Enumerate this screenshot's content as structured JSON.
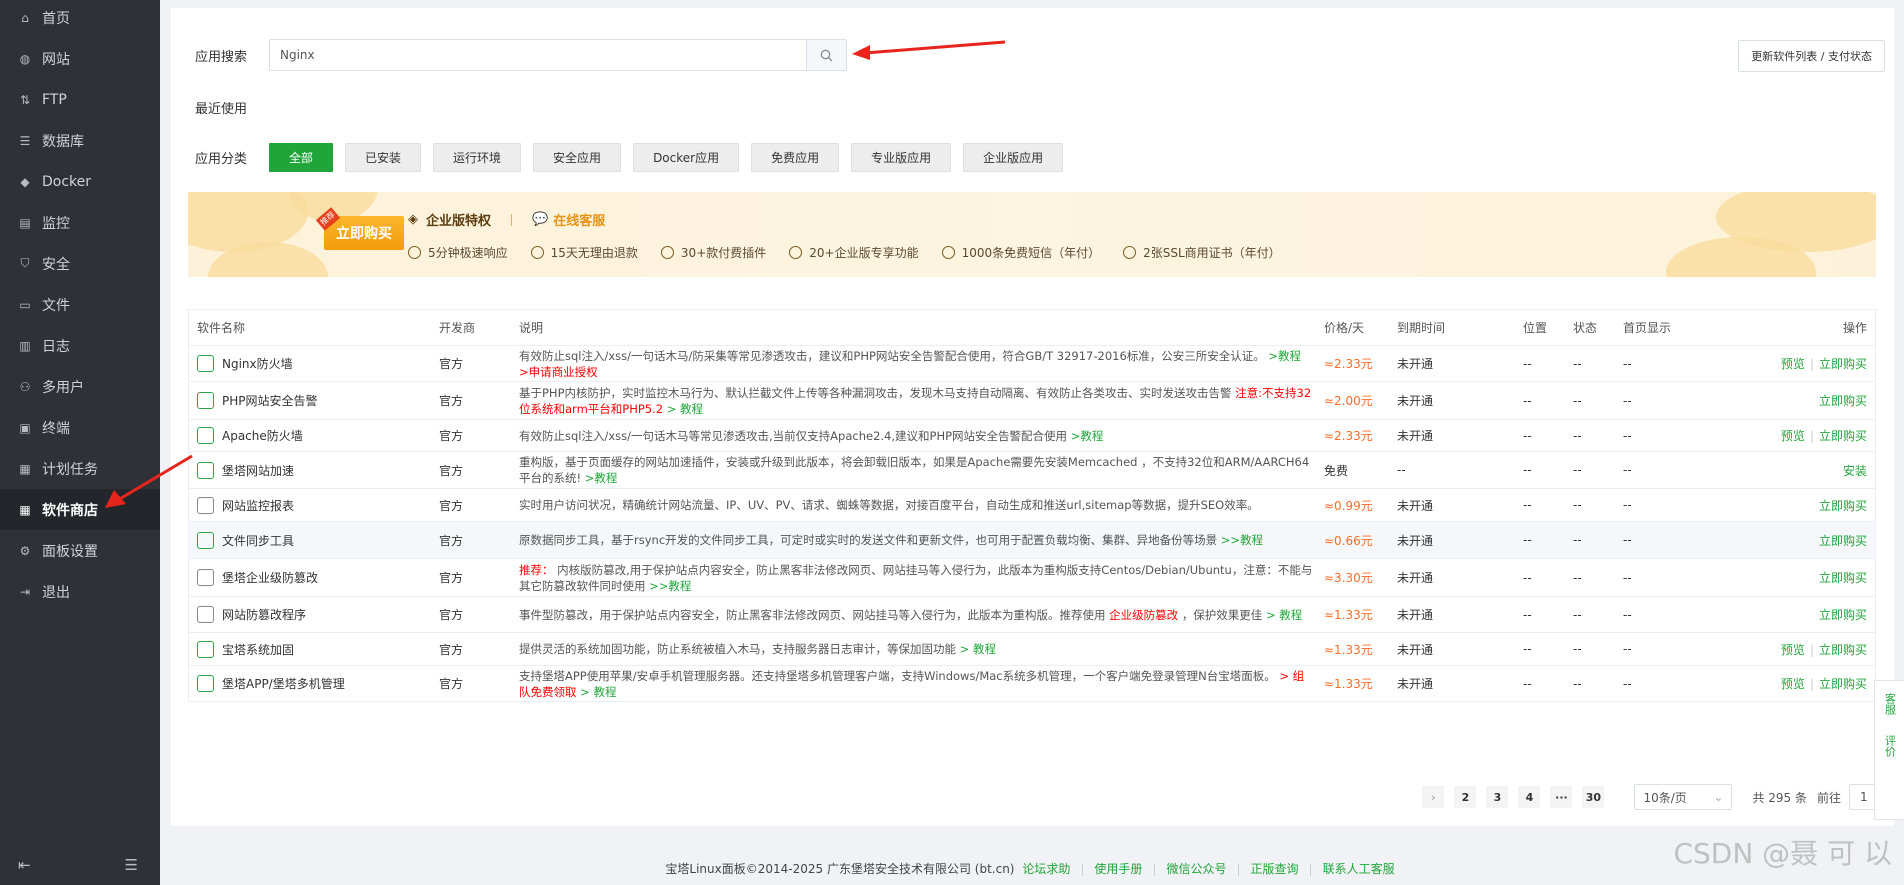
{
  "sidebar": {
    "items": [
      {
        "label": "首页",
        "icon": "home-icon"
      },
      {
        "label": "网站",
        "icon": "globe-icon"
      },
      {
        "label": "FTP",
        "icon": "ftp-icon"
      },
      {
        "label": "数据库",
        "icon": "database-icon"
      },
      {
        "label": "Docker",
        "icon": "docker-icon"
      },
      {
        "label": "监控",
        "icon": "monitor-icon"
      },
      {
        "label": "安全",
        "icon": "shield-icon"
      },
      {
        "label": "文件",
        "icon": "folder-icon"
      },
      {
        "label": "日志",
        "icon": "log-icon"
      },
      {
        "label": "多用户",
        "icon": "users-icon"
      },
      {
        "label": "终端",
        "icon": "terminal-icon"
      },
      {
        "label": "计划任务",
        "icon": "calendar-icon"
      },
      {
        "label": "软件商店",
        "icon": "apps-icon",
        "active": true
      },
      {
        "label": "面板设置",
        "icon": "gear-icon"
      },
      {
        "label": "退出",
        "icon": "logout-icon"
      }
    ]
  },
  "search": {
    "label": "应用搜索",
    "value": "Nginx"
  },
  "update_button": "更新软件列表 / 支付状态",
  "recent_label": "最近使用",
  "category": {
    "label": "应用分类",
    "items": [
      "全部",
      "已安装",
      "运行环境",
      "安全应用",
      "Docker应用",
      "免费应用",
      "专业版应用",
      "企业版应用"
    ]
  },
  "banner": {
    "buy_label": "立即购买",
    "tag": "推荐",
    "enterprise": "企业版特权",
    "online": "在线客服",
    "features": [
      "5分钟极速响应",
      "15天无理由退款",
      "30+款付费插件",
      "20+企业版专享功能",
      "1000条免费短信（年付）",
      "2张SSL商用证书（年付）"
    ]
  },
  "table": {
    "headers": {
      "name": "软件名称",
      "dev": "开发商",
      "desc": "说明",
      "price": "价格/天",
      "expire": "到期时间",
      "pos": "位置",
      "status": "状态",
      "home": "首页显示",
      "op": "操作"
    },
    "rows": [
      {
        "name": "Nginx防火墙",
        "dev": "官方",
        "desc": "有效防止sql注入/xss/一句话木马/防采集等常见渗透攻击，建议和PHP网站安全告警配合使用，符合GB/T 32917-2016标准，公安三所安全认证。",
        "desc_link": ">教程",
        "desc_red": ">申请商业授权",
        "price": "≈2.33元",
        "expire": "未开通",
        "pos": "--",
        "status": "--",
        "home": "--",
        "op_preview": "预览",
        "op_main": "立即购买"
      },
      {
        "name": "PHP网站安全告警",
        "dev": "官方",
        "desc": "基于PHP内核防护，实时监控木马行为、默认拦截文件上传等各种漏洞攻击，发现木马支持自动隔离、有效防止各类攻击、实时发送攻击告警",
        "desc_red": "注意:不支持32位系统和arm平台和PHP5.2",
        "desc_link": "> 教程",
        "price": "≈2.00元",
        "expire": "未开通",
        "pos": "--",
        "status": "--",
        "home": "--",
        "op_preview": "",
        "op_main": "立即购买"
      },
      {
        "name": "Apache防火墙",
        "dev": "官方",
        "desc": "有效防止sql注入/xss/一句话木马等常见渗透攻击,当前仅支持Apache2.4,建议和PHP网站安全告警配合使用",
        "desc_link": ">教程",
        "desc_red": "",
        "price": "≈2.33元",
        "expire": "未开通",
        "pos": "--",
        "status": "--",
        "home": "--",
        "op_preview": "预览",
        "op_main": "立即购买"
      },
      {
        "name": "堡塔网站加速",
        "dev": "官方",
        "desc": "重构版，基于页面缓存的网站加速插件，安装或升级到此版本，将会卸载旧版本，如果是Apache需要先安装Memcached ，不支持32位和ARM/AARCH64平台的系统!",
        "desc_link": ">教程",
        "desc_red": "",
        "price": "免费",
        "expire": "--",
        "pos": "--",
        "status": "--",
        "home": "--",
        "op_preview": "",
        "op_main": "安装"
      },
      {
        "name": "网站监控报表",
        "dev": "官方",
        "desc": "实时用户访问状况，精确统计网站流量、IP、UV、PV、请求、蜘蛛等数据，对接百度平台，自动生成和推送url,sitemap等数据，提升SEO效率。",
        "desc_link": "",
        "desc_red": "",
        "price": "≈0.99元",
        "expire": "未开通",
        "pos": "--",
        "status": "--",
        "home": "--",
        "op_preview": "",
        "op_main": "立即购买"
      },
      {
        "name": "文件同步工具",
        "dev": "官方",
        "desc": "原数据同步工具，基于rsync开发的文件同步工具，可定时或实时的发送文件和更新文件，也可用于配置负载均衡、集群、异地备份等场景",
        "desc_link": ">>教程",
        "desc_red": "",
        "price": "≈0.66元",
        "expire": "未开通",
        "pos": "--",
        "status": "--",
        "home": "--",
        "op_preview": "",
        "op_main": "立即购买"
      },
      {
        "name": "堡塔企业级防篡改",
        "dev": "官方",
        "desc_prefix_red": "推荐：",
        "desc": "内核版防篡改,用于保护站点内容安全，防止黑客非法修改网页、网站挂马等入侵行为，此版本为重构版支持Centos/Debian/Ubuntu，注意：不能与其它防篡改软件同时使用",
        "desc_link": ">>教程",
        "desc_red": "",
        "price": "≈3.30元",
        "expire": "未开通",
        "pos": "--",
        "status": "--",
        "home": "--",
        "op_preview": "",
        "op_main": "立即购买"
      },
      {
        "name": "网站防篡改程序",
        "dev": "官方",
        "desc": "事件型防篡改，用于保护站点内容安全，防止黑客非法修改网页、网站挂马等入侵行为，此版本为重构版。推荐使用",
        "desc_red": "企业级防篡改",
        "desc_suffix": "，保护效果更佳",
        "desc_link": "> 教程",
        "price": "≈1.33元",
        "expire": "未开通",
        "pos": "--",
        "status": "--",
        "home": "--",
        "op_preview": "",
        "op_main": "立即购买"
      },
      {
        "name": "宝塔系统加固",
        "dev": "官方",
        "desc": "提供灵活的系统加固功能，防止系统被植入木马，支持服务器日志审计，等保加固功能",
        "desc_link": "> 教程",
        "desc_red": "",
        "price": "≈1.33元",
        "expire": "未开通",
        "pos": "--",
        "status": "--",
        "home": "--",
        "op_preview": "预览",
        "op_main": "立即购买"
      },
      {
        "name": "堡塔APP/堡塔多机管理",
        "dev": "官方",
        "desc": "支持堡塔APP使用苹果/安卓手机管理服务器。还支持堡塔多机管理客户端，支持Windows/Mac系统多机管理，一个客户端免登录管理N台宝塔面板。",
        "desc_red": "> 组队免费领取",
        "desc_link": "> 教程",
        "price": "≈1.33元",
        "expire": "未开通",
        "pos": "--",
        "status": "--",
        "home": "--",
        "op_preview": "预览",
        "op_main": "立即购买"
      }
    ]
  },
  "pagination": {
    "pages": [
      "1",
      "2",
      "3",
      "4",
      "···",
      "30"
    ],
    "page_size": "10条/页",
    "total": "共 295 条",
    "goto_label": "前往",
    "goto_value": "1"
  },
  "footer": {
    "copyright": "宝塔Linux面板©2014-2025 广东堡塔安全技术有限公司 (bt.cn)",
    "links": [
      "论坛求助",
      "使用手册",
      "微信公众号",
      "正版查询",
      "联系人工客服"
    ]
  },
  "float": {
    "service": "客服",
    "review": "评价"
  },
  "watermark": "CSDN @聂 可 以",
  "colors": {
    "accent": "#20a53a",
    "sidebar": "#2f3137",
    "price": "#fc6d26",
    "warning": "#ff0000"
  }
}
